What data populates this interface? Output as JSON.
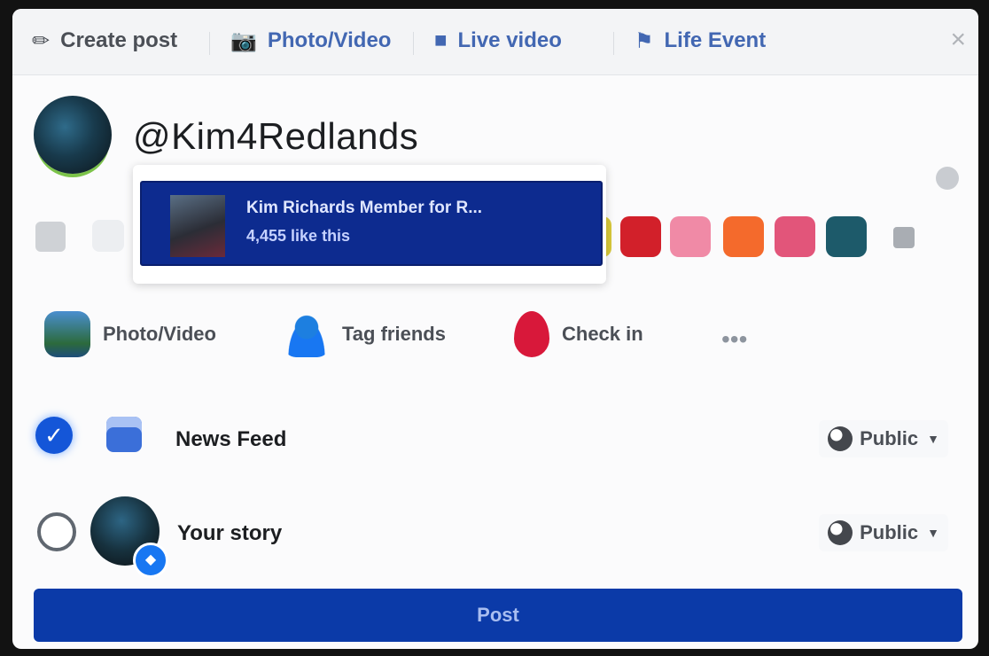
{
  "tabs": [
    {
      "label": "Create post",
      "icon": "pencil-icon"
    },
    {
      "label": "Photo/Video",
      "icon": "camera-icon"
    },
    {
      "label": "Live video",
      "icon": "video-camera-icon"
    },
    {
      "label": "Life Event",
      "icon": "flag-icon"
    }
  ],
  "composer": {
    "text": "@Kim4Redlands"
  },
  "mention_suggestion": {
    "name": "Kim Richards Member for R...",
    "likes": "4,455 like this"
  },
  "background_swatches": [
    "#f2f2f2",
    "#d8c93a",
    "#d2202a",
    "#f08aa6",
    "#f46a2c",
    "#e2557a",
    "#1d5a6a"
  ],
  "actions": [
    {
      "label": "Photo/Video",
      "icon": "photo-icon"
    },
    {
      "label": "Tag friends",
      "icon": "tag-friends-icon"
    },
    {
      "label": "Check in",
      "icon": "location-pin-icon"
    },
    {
      "label": "•••",
      "icon": "more-icon"
    }
  ],
  "destinations": [
    {
      "label": "News Feed",
      "privacy": "Public",
      "checked": true
    },
    {
      "label": "Your story",
      "privacy": "Public",
      "checked": false
    }
  ],
  "post_button": "Post",
  "colors": {
    "brand_blue": "#1877f2",
    "post_button": "#0b3aa8",
    "mention_highlight": "#0d2b8f"
  }
}
